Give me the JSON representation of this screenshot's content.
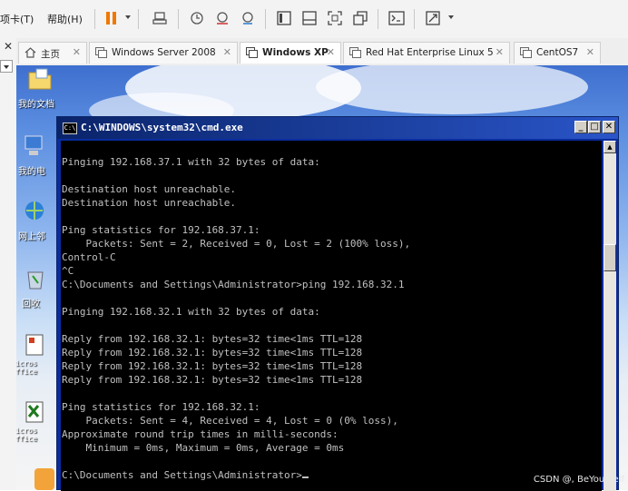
{
  "toolbar": {
    "tab_menu_label": "项卡(T)",
    "help_menu_label": "帮助(H)"
  },
  "tabs": [
    {
      "label": "主页",
      "icon": "home-icon",
      "active": false
    },
    {
      "label": "Windows Server 2008",
      "icon": "vm-icon",
      "active": false
    },
    {
      "label": "Windows XP",
      "icon": "vm-icon",
      "active": true
    },
    {
      "label": "Red Hat Enterprise Linux 5",
      "icon": "vm-icon",
      "active": false
    },
    {
      "label": "CentOS7",
      "icon": "vm-icon",
      "active": false
    }
  ],
  "desktop": {
    "icons": [
      {
        "label": "我的文档",
        "icon": "folder-icon"
      },
      {
        "label": "我的电",
        "icon": "computer-icon"
      },
      {
        "label": "网上邻",
        "icon": "network-icon"
      },
      {
        "label": "回收",
        "icon": "recycle-bin-icon"
      },
      {
        "label": "Micros\nOffice",
        "icon": "office-icon"
      },
      {
        "label": "Micros\nOffice",
        "icon": "excel-icon"
      }
    ]
  },
  "cmd": {
    "title": "C:\\WINDOWS\\system32\\cmd.exe",
    "lines": [
      "Pinging 192.168.37.1 with 32 bytes of data:",
      "",
      "Destination host unreachable.",
      "Destination host unreachable.",
      "",
      "Ping statistics for 192.168.37.1:",
      "    Packets: Sent = 2, Received = 0, Lost = 2 (100% loss),",
      "Control-C",
      "^C",
      "C:\\Documents and Settings\\Administrator>ping 192.168.32.1",
      "",
      "Pinging 192.168.32.1 with 32 bytes of data:",
      "",
      "Reply from 192.168.32.1: bytes=32 time<1ms TTL=128",
      "Reply from 192.168.32.1: bytes=32 time<1ms TTL=128",
      "Reply from 192.168.32.1: bytes=32 time<1ms TTL=128",
      "Reply from 192.168.32.1: bytes=32 time<1ms TTL=128",
      "",
      "Ping statistics for 192.168.32.1:",
      "    Packets: Sent = 4, Received = 4, Lost = 0 (0% loss),",
      "Approximate round trip times in milli-seconds:",
      "    Minimum = 0ms, Maximum = 0ms, Average = 0ms",
      "",
      "C:\\Documents and Settings\\Administrator>"
    ]
  },
  "watermark": "CSDN @, BeYourself",
  "colors": {
    "console_bg": "#000000",
    "console_fg": "#c0c0c0",
    "title_bar": "#0a246a",
    "pause_icon": "#f07800"
  }
}
